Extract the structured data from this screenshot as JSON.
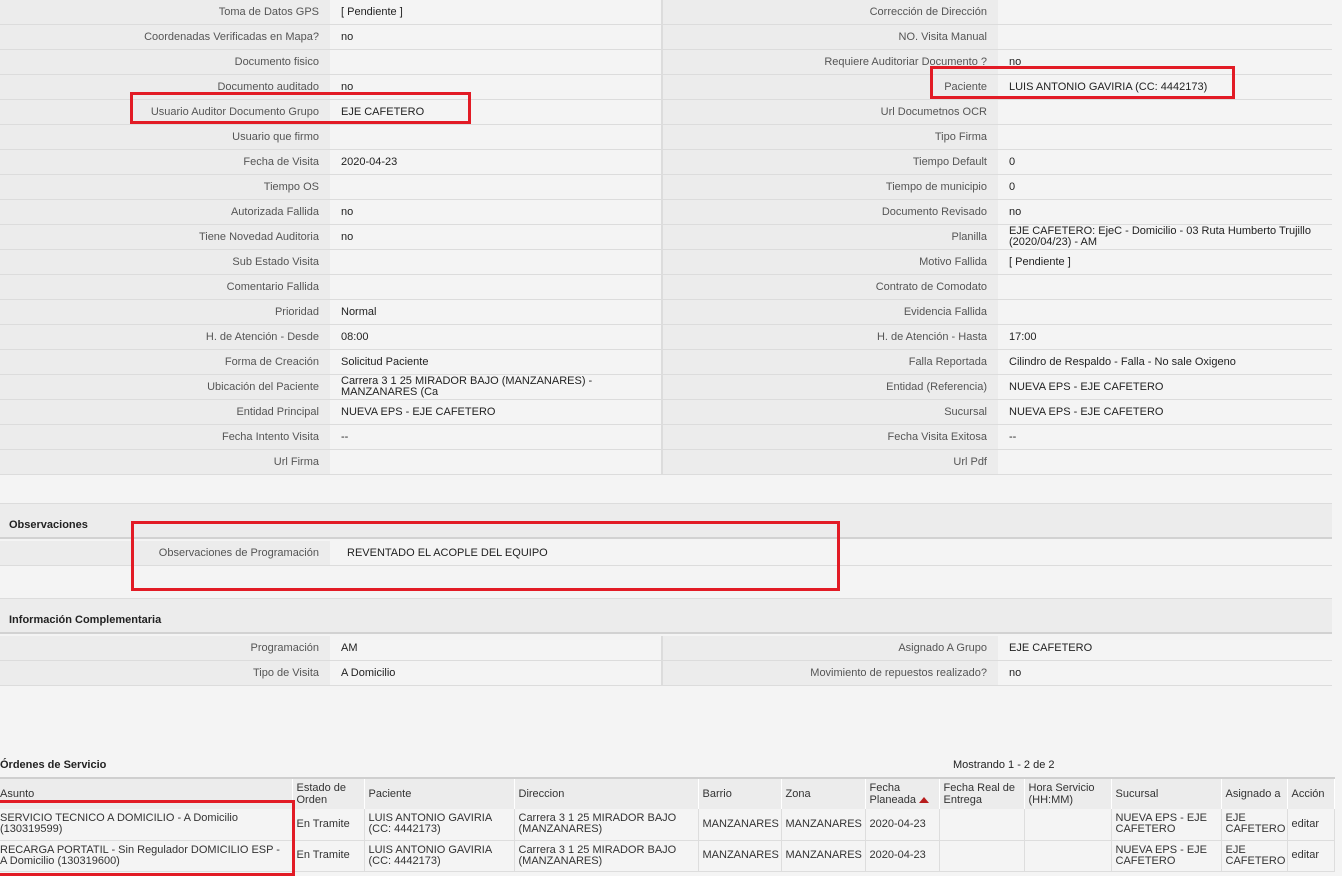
{
  "main_rows": [
    {
      "l1": "Toma de Datos GPS",
      "v1": "[ Pendiente ]",
      "l2": "Corrección de Dirección",
      "v2": ""
    },
    {
      "l1": "Coordenadas Verificadas en Mapa?",
      "v1": "no",
      "l2": "NO. Visita Manual",
      "v2": ""
    },
    {
      "l1": "Documento fisico",
      "v1": "",
      "l2": "Requiere Auditoriar Documento ?",
      "v2": "no"
    },
    {
      "l1": "Documento auditado",
      "v1": "no",
      "l2": "Paciente",
      "v2": "LUIS ANTONIO GAVIRIA (CC: 4442173)"
    },
    {
      "l1": "Usuario Auditor Documento Grupo",
      "v1": "EJE CAFETERO",
      "l2": "Url Documetnos OCR",
      "v2": ""
    },
    {
      "l1": "Usuario que firmo",
      "v1": "",
      "l2": "Tipo Firma",
      "v2": ""
    },
    {
      "l1": "Fecha de Visita",
      "v1": "2020-04-23",
      "l2": "Tiempo Default",
      "v2": "0"
    },
    {
      "l1": "Tiempo OS",
      "v1": "",
      "l2": "Tiempo de municipio",
      "v2": "0"
    },
    {
      "l1": "Autorizada Fallida",
      "v1": "no",
      "l2": "Documento Revisado",
      "v2": "no"
    },
    {
      "l1": "Tiene Novedad Auditoria",
      "v1": "no",
      "l2": "Planilla",
      "v2": "EJE CAFETERO: EjeC - Domicilio - 03 Ruta Humberto Trujillo (2020/04/23) - AM"
    },
    {
      "l1": "Sub Estado Visita",
      "v1": "",
      "l2": "Motivo Fallida",
      "v2": "[ Pendiente ]"
    },
    {
      "l1": "Comentario Fallida",
      "v1": "",
      "l2": "Contrato de Comodato",
      "v2": ""
    },
    {
      "l1": "Prioridad",
      "v1": "Normal",
      "l2": "Evidencia Fallida",
      "v2": ""
    },
    {
      "l1": "H. de Atención - Desde",
      "v1": "08:00",
      "l2": "H. de Atención - Hasta",
      "v2": "17:00"
    },
    {
      "l1": "Forma de Creación",
      "v1": "Solicitud Paciente",
      "l2": "Falla Reportada",
      "v2": "Cilindro de Respaldo - Falla - No sale Oxigeno"
    },
    {
      "l1": "Ubicación del Paciente",
      "v1": "Carrera 3 1 25 MIRADOR BAJO (MANZANARES) - MANZANARES (Ca",
      "l2": "Entidad (Referencia)",
      "v2": "NUEVA EPS - EJE CAFETERO"
    },
    {
      "l1": "Entidad Principal",
      "v1": "NUEVA EPS - EJE CAFETERO",
      "l2": "Sucursal",
      "v2": "NUEVA EPS - EJE CAFETERO"
    },
    {
      "l1": "Fecha Intento Visita",
      "v1": "--",
      "l2": "Fecha Visita Exitosa",
      "v2": "--"
    },
    {
      "l1": "Url Firma",
      "v1": "",
      "l2": "Url Pdf",
      "v2": ""
    }
  ],
  "observaciones": {
    "title": "Observaciones",
    "label": "Observaciones de Programación",
    "value": "REVENTADO EL ACOPLE DEL EQUIPO"
  },
  "info": {
    "title": "Información Complementaria",
    "rows": [
      {
        "l1": "Programación",
        "v1": "AM",
        "l2": "Asignado A Grupo",
        "v2": "EJE CAFETERO"
      },
      {
        "l1": "Tipo de Visita",
        "v1": "A Domicilio",
        "l2": "Movimiento de repuestos realizado?",
        "v2": "no"
      }
    ]
  },
  "orders": {
    "title": "Órdenes de Servicio",
    "count": "Mostrando 1 - 2 de 2",
    "headers": [
      "Asunto",
      "Estado de Orden",
      "Paciente",
      "Direccion",
      "Barrio",
      "Zona",
      "Fecha Planeada",
      "Fecha Real de Entrega",
      "Hora Servicio (HH:MM)",
      "Sucursal",
      "Asignado a",
      "Acción"
    ],
    "rows": [
      [
        "SERVICIO TECNICO A DOMICILIO - A Domicilio (130319599)",
        "En Tramite",
        "LUIS ANTONIO GAVIRIA (CC: 4442173)",
        "Carrera 3 1 25 MIRADOR BAJO (MANZANARES)",
        "MANZANARES",
        "MANZANARES",
        "2020-04-23",
        "",
        "",
        "NUEVA EPS - EJE CAFETERO",
        "EJE CAFETERO",
        "editar"
      ],
      [
        "RECARGA PORTATIL - Sin Regulador DOMICILIO ESP - A Domicilio (130319600)",
        "En Tramite",
        "LUIS ANTONIO GAVIRIA (CC: 4442173)",
        "Carrera 3 1 25 MIRADOR BAJO (MANZANARES)",
        "MANZANARES",
        "MANZANARES",
        "2020-04-23",
        "",
        "",
        "NUEVA EPS - EJE CAFETERO",
        "EJE CAFETERO",
        "editar"
      ]
    ]
  },
  "colors": {
    "highlight": "#e21b25",
    "sort_arrow": "#b71c1c"
  },
  "icons": {
    "sort": "sort-ascending-icon"
  }
}
